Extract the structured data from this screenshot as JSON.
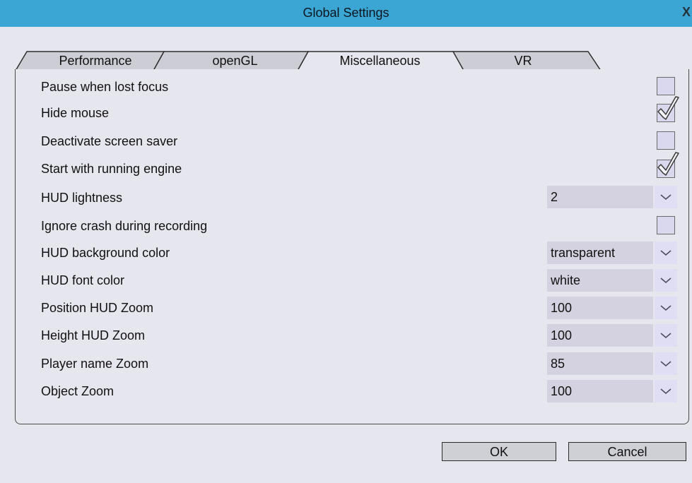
{
  "window": {
    "title": "Global Settings",
    "close_glyph": "X"
  },
  "tabs": [
    {
      "label": "Performance",
      "active": false
    },
    {
      "label": "openGL",
      "active": false
    },
    {
      "label": "Miscellaneous",
      "active": true
    },
    {
      "label": "VR",
      "active": false
    }
  ],
  "settings": [
    {
      "label": "Pause when lost focus",
      "type": "checkbox",
      "checked": false
    },
    {
      "label": "Hide mouse",
      "type": "checkbox",
      "checked": true
    },
    {
      "label": "Deactivate screen saver",
      "type": "checkbox",
      "checked": false
    },
    {
      "label": "Start with running engine",
      "type": "checkbox",
      "checked": true
    },
    {
      "label": "HUD lightness",
      "type": "select",
      "value": "2"
    },
    {
      "label": "Ignore crash during recording",
      "type": "checkbox",
      "checked": false
    },
    {
      "label": "HUD background color",
      "type": "select",
      "value": "transparent"
    },
    {
      "label": "HUD font color",
      "type": "select",
      "value": "white"
    },
    {
      "label": "Position HUD Zoom",
      "type": "select",
      "value": "100"
    },
    {
      "label": "Height HUD Zoom",
      "type": "select",
      "value": "100"
    },
    {
      "label": "Player name Zoom",
      "type": "select",
      "value": "85"
    },
    {
      "label": "Object Zoom",
      "type": "select",
      "value": "100"
    }
  ],
  "buttons": {
    "ok_label": "OK",
    "cancel_label": "Cancel"
  },
  "colors": {
    "titlebar": "#3ba6d4",
    "background": "#e6e6ee",
    "active_tab": "#e6e6ee",
    "inactive_tab": "#cdcdd6",
    "checkbox_fill": "#dad8ef",
    "select_fill": "#d4d2e0"
  },
  "icons": {
    "checkbox_checked": "checkmark-icon",
    "select_arrow": "chevron-down-icon",
    "close": "close-icon"
  }
}
